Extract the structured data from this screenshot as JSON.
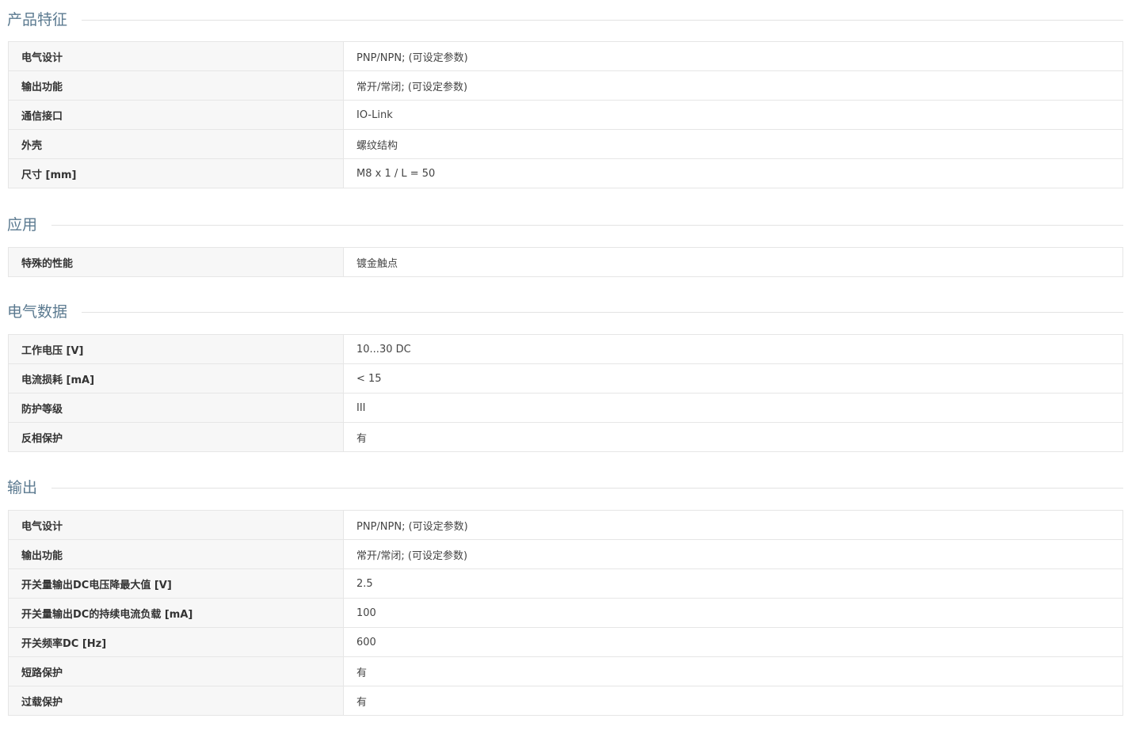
{
  "sections": [
    {
      "title": "产品特征",
      "rows": [
        {
          "label": "电气设计",
          "value": "PNP/NPN; (可设定参数)"
        },
        {
          "label": "输出功能",
          "value": "常开/常闭; (可设定参数)"
        },
        {
          "label": "通信接口",
          "value": "IO-Link"
        },
        {
          "label": "外壳",
          "value": "螺纹结构"
        },
        {
          "label": "尺寸 [mm]",
          "value": "M8 x 1 / L = 50"
        }
      ]
    },
    {
      "title": "应用",
      "rows": [
        {
          "label": "特殊的性能",
          "value": "镀金触点"
        }
      ]
    },
    {
      "title": "电气数据",
      "rows": [
        {
          "label": "工作电压 [V]",
          "value": "10...30 DC"
        },
        {
          "label": "电流损耗 [mA]",
          "value": "< 15"
        },
        {
          "label": "防护等级",
          "value": "III"
        },
        {
          "label": "反相保护",
          "value": "有"
        }
      ]
    },
    {
      "title": "输出",
      "rows": [
        {
          "label": "电气设计",
          "value": "PNP/NPN; (可设定参数)"
        },
        {
          "label": "输出功能",
          "value": "常开/常闭; (可设定参数)"
        },
        {
          "label": "开关量输出DC电压降最大值 [V]",
          "value": "2.5"
        },
        {
          "label": "开关量输出DC的持续电流负载 [mA]",
          "value": "100"
        },
        {
          "label": "开关频率DC [Hz]",
          "value": "600"
        },
        {
          "label": "短路保护",
          "value": "有"
        },
        {
          "label": "过载保护",
          "value": "有"
        }
      ]
    }
  ]
}
